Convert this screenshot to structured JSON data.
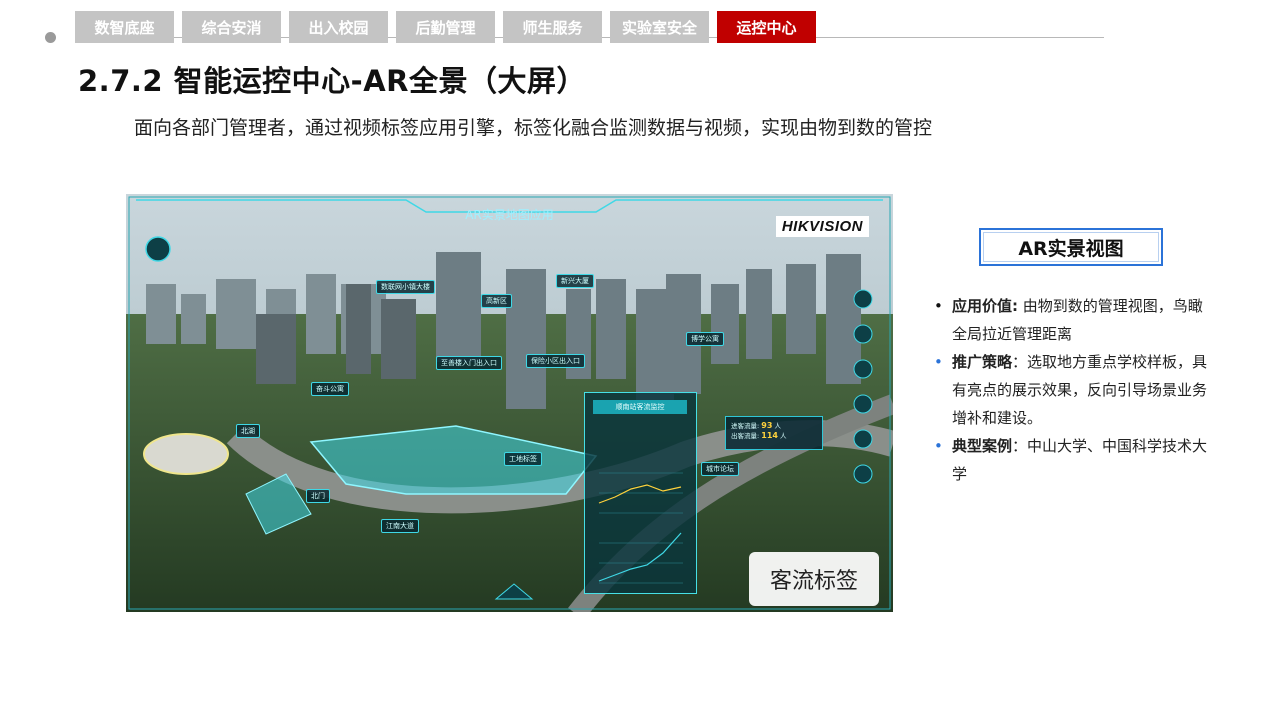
{
  "nav": {
    "tabs": [
      {
        "label": "数智底座",
        "active": false
      },
      {
        "label": "综合安消",
        "active": false
      },
      {
        "label": "出入校园",
        "active": false
      },
      {
        "label": "后勤管理",
        "active": false
      },
      {
        "label": "师生服务",
        "active": false
      },
      {
        "label": "实验室安全",
        "active": false
      },
      {
        "label": "运控中心",
        "active": true
      }
    ]
  },
  "page": {
    "title": "2.7.2 智能运控中心-AR全景（大屏）",
    "subtitle": "面向各部门管理者，通过视频标签应用引擎，标签化融合监测数据与视频，实现由物到数的管控"
  },
  "screenshot": {
    "app_title": "AR实景地图应用",
    "brand": "HIKVISION",
    "badge": "客流标签",
    "tags": [
      "数联网小镇大楼",
      "高新区",
      "新兴大厦",
      "北湖",
      "至善楼入门出入口",
      "保险小区出入口",
      "奋斗公寓",
      "博学公寓",
      "城市论坛",
      "江南大道",
      "工地标签",
      "北门"
    ],
    "panel_title": "顺南站客流监控",
    "stat": {
      "label1": "进客流量",
      "value1": "93",
      "label2": "出客流量",
      "value2": "114",
      "unit": "人"
    }
  },
  "side": {
    "box_title": "AR实景视图",
    "bullets": [
      {
        "key": "应用价值:",
        "text": " 由物到数的管理视图，鸟瞰全局拉近管理距离",
        "color": "#111111"
      },
      {
        "key": "推广策略",
        "text": "：选取地方重点学校样板，具有亮点的展示效果，反向引导场景业务增补和建设。",
        "color": "#2b73d8"
      },
      {
        "key": "典型案例",
        "text": "：中山大学、中国科学技术大学",
        "color": "#2b73d8"
      }
    ]
  },
  "colors": {
    "accent": "#c00000",
    "tab_inactive": "#c4c4c4",
    "blue": "#2b73d8",
    "hud": "#3fd8e6"
  }
}
